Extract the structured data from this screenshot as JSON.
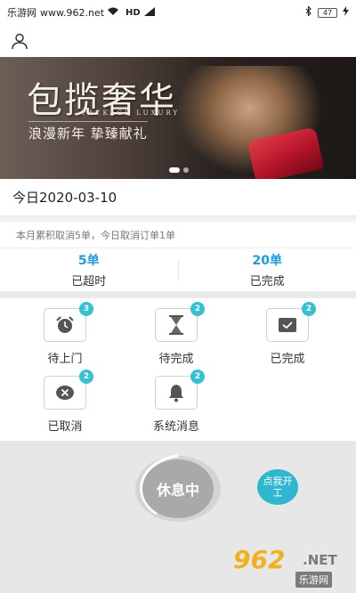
{
  "status_bar": {
    "carrier": "乐游网",
    "site": "www.962.net",
    "network": "HD",
    "battery": "47",
    "icons": [
      "wifi-icon",
      "hd-icon",
      "bluetooth-icon",
      "battery-icon",
      "charging-icon"
    ]
  },
  "header": {
    "profile_icon": "user-icon"
  },
  "banner": {
    "title": "包揽奢华",
    "subtitle_en": "PACKAGE LUXURY",
    "slogan": "浪漫新年 挚臻献礼"
  },
  "date": {
    "text": "今日2020-03-10"
  },
  "summary": {
    "text": "本月累积取消5单，今日取消订单1单"
  },
  "stats": [
    {
      "value": "5单",
      "label": "已超时"
    },
    {
      "value": "20单",
      "label": "已完成"
    }
  ],
  "grid": [
    {
      "label": "待上门",
      "badge": "3",
      "icon": "alarm-clock-icon"
    },
    {
      "label": "待完成",
      "badge": "2",
      "icon": "hourglass-icon"
    },
    {
      "label": "已完成",
      "badge": "2",
      "icon": "check-box-icon"
    },
    {
      "label": "已取消",
      "badge": "2",
      "icon": "cancel-icon"
    },
    {
      "label": "系统消息",
      "badge": "2",
      "icon": "bell-icon"
    }
  ],
  "actions": {
    "rest_label": "休息中",
    "work_label": "点我开工"
  },
  "watermark": {
    "num": "962",
    "net": ".NET",
    "cn": "乐游网"
  },
  "colors": {
    "accent_blue": "#1e9be0",
    "badge_teal": "#34c2d2",
    "work_button": "#2fb7cf",
    "rest_button": "#a9a9a9"
  }
}
